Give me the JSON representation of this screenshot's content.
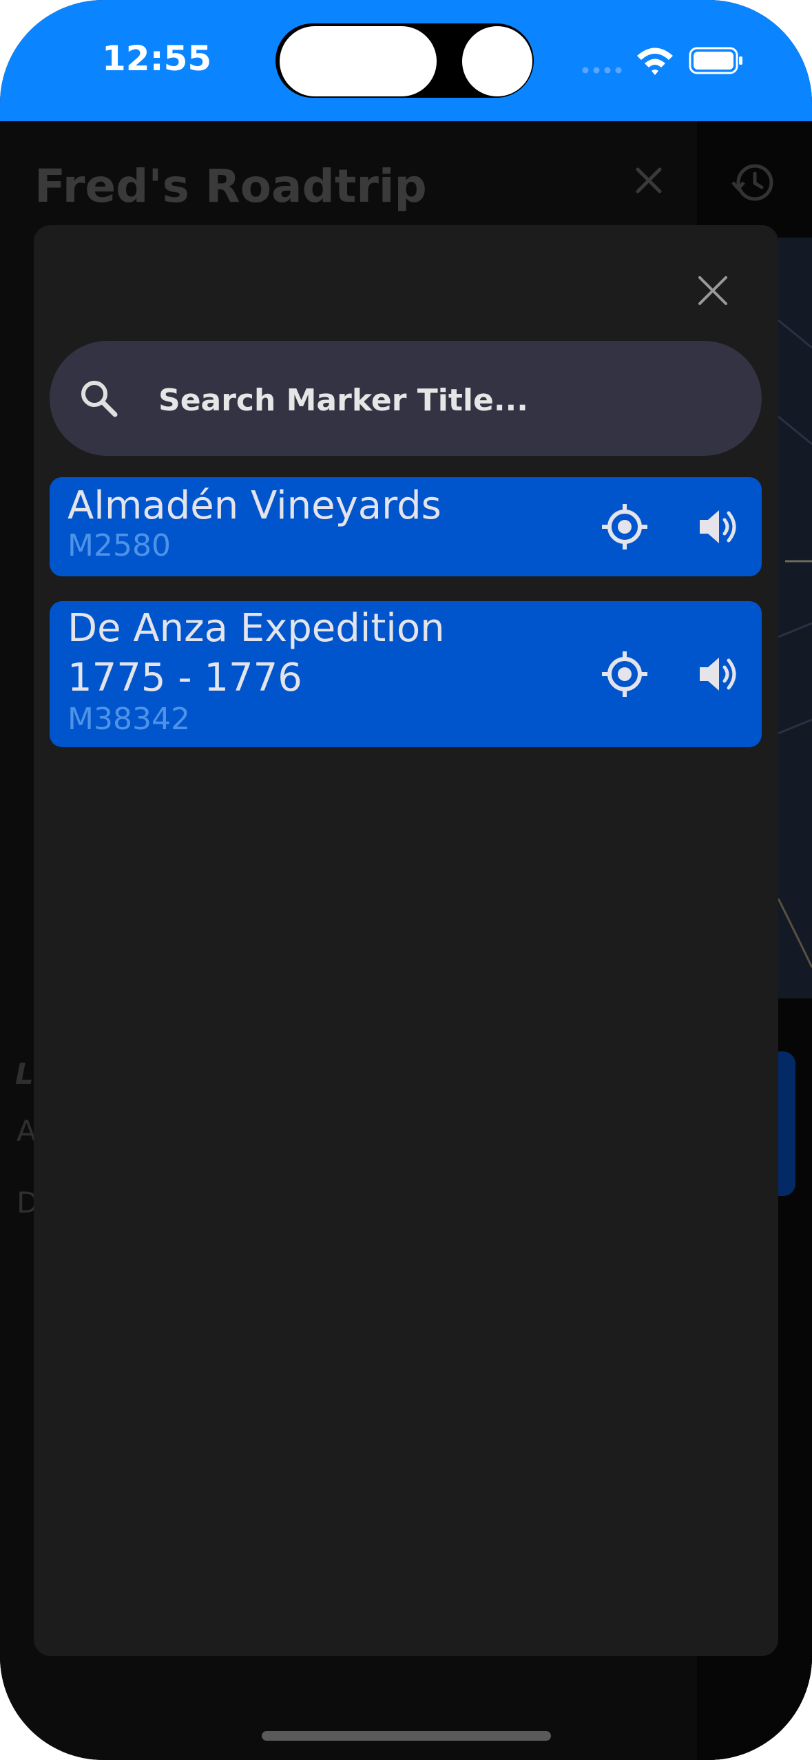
{
  "status_bar": {
    "time": "12:55",
    "accent_color": "#0a84ff"
  },
  "background_app": {
    "title": "Fred's Roadtrip",
    "partial_letters": [
      "L",
      "A",
      "D"
    ],
    "icons": [
      "close-icon",
      "history-icon"
    ]
  },
  "modal": {
    "close_icon": "close-icon",
    "search": {
      "placeholder": "Search Marker Title...",
      "value": "",
      "icon": "search-icon"
    },
    "results": [
      {
        "title": "Almadén Vineyards",
        "id": "M2580",
        "icons": [
          "target-icon",
          "volume-icon"
        ]
      },
      {
        "title_line1": "De Anza Expedition",
        "title_line2": "1775 - 1776",
        "id": "M38342",
        "icons": [
          "target-icon",
          "volume-icon"
        ]
      }
    ]
  },
  "colors": {
    "card": "#0055cc",
    "modal": "#1c1c1c",
    "search_bar": "#333344",
    "id_text": "#4f93e8"
  }
}
